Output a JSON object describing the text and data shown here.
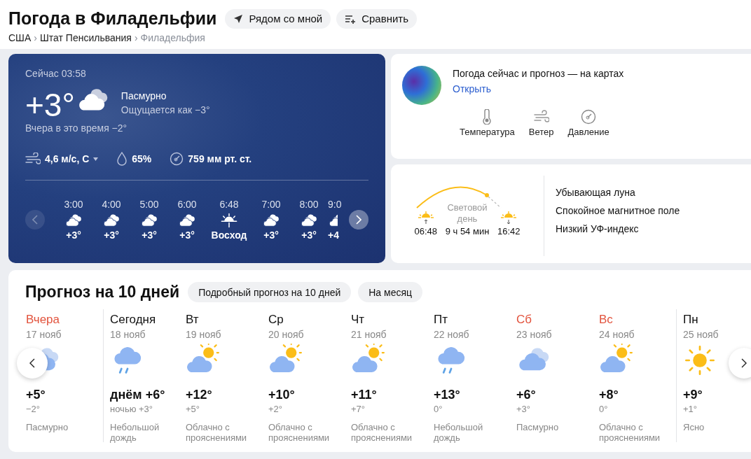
{
  "header": {
    "title": "Погода в Филадельфии",
    "buttons": [
      {
        "label": "Рядом со мной",
        "kind": "location"
      },
      {
        "label": "Сравнить",
        "kind": "compare"
      }
    ],
    "breadcrumbs": [
      {
        "label": "США",
        "current": false
      },
      {
        "separator": "›",
        "label": "Штат Пенсильвания",
        "current": false
      },
      {
        "separator": "›",
        "label": "Филадельфия",
        "current": true
      }
    ]
  },
  "now": {
    "time": "Сейчас 03:58",
    "temperature": "+3°",
    "condition": "Пасмурно",
    "feels_like": "Ощущается как −3°",
    "yesterday": "Вчера в это время −2°",
    "details": [
      {
        "kind": "wind",
        "value": "4,6 м/с, С"
      },
      {
        "kind": "humidity",
        "value": "65%"
      },
      {
        "kind": "pressure",
        "value": "759 мм рт. ст."
      }
    ],
    "hourly_prev": {
      "disabled": true
    },
    "hourly_next": {
      "disabled": false
    },
    "hourly": [
      {
        "time": "3:00",
        "kind": "hour",
        "value": "+3°"
      },
      {
        "time": "4:00",
        "kind": "hour",
        "value": "+3°"
      },
      {
        "time": "5:00",
        "kind": "hour",
        "value": "+3°"
      },
      {
        "time": "6:00",
        "kind": "hour",
        "value": "+3°"
      },
      {
        "time": "6:48",
        "kind": "sunrise",
        "value": "Восход"
      },
      {
        "time": "7:00",
        "kind": "hour",
        "value": "+3°"
      },
      {
        "time": "8:00",
        "kind": "hour",
        "value": "+3°"
      },
      {
        "time": "9:0",
        "kind": "hour",
        "value": "+4"
      }
    ]
  },
  "maps": {
    "title": "Погода сейчас и прогноз — на картах",
    "link": "Открыть",
    "layers": [
      {
        "label": "Температура",
        "kind": "thermometer"
      },
      {
        "label": "Ветер",
        "kind": "wind"
      },
      {
        "label": "Давление",
        "kind": "gauge"
      }
    ]
  },
  "sun": {
    "sunrise": "06:48",
    "daylight_label": "Световой день",
    "daylight": "9 ч 54 мин",
    "sunset": "16:42",
    "facts": [
      "Убывающая луна",
      "Спокойное магнитное поле",
      "Низкий УФ-индекс"
    ]
  },
  "forecast": {
    "title": "Прогноз на 10 дней",
    "buttons": [
      "Подробный прогноз на 10 дней",
      "На месяц"
    ],
    "days": [
      {
        "name": "Вчера",
        "accent": true,
        "separator_before": false,
        "date": "17 нояб",
        "kind": "overcast",
        "day": "+5°",
        "night": "−2°",
        "summary": "Пасмурно"
      },
      {
        "name": "Сегодня",
        "accent": false,
        "separator_before": true,
        "date": "18 нояб",
        "kind": "rain",
        "day": "днём +6°",
        "night": "ночью +3°",
        "summary": "Небольшой дождь"
      },
      {
        "name": "Вт",
        "accent": false,
        "separator_before": false,
        "date": "19 нояб",
        "kind": "partly",
        "day": "+12°",
        "night": "+5°",
        "summary": "Облачно с прояснениями"
      },
      {
        "name": "Ср",
        "accent": false,
        "separator_before": false,
        "date": "20 нояб",
        "kind": "partly",
        "day": "+10°",
        "night": "+2°",
        "summary": "Облачно с прояснениями"
      },
      {
        "name": "Чт",
        "accent": false,
        "separator_before": false,
        "date": "21 нояб",
        "kind": "partly",
        "day": "+11°",
        "night": "+7°",
        "summary": "Облачно с прояснениями"
      },
      {
        "name": "Пт",
        "accent": false,
        "separator_before": false,
        "date": "22 нояб",
        "kind": "rain",
        "day": "+13°",
        "night": "0°",
        "summary": "Небольшой дождь"
      },
      {
        "name": "Сб",
        "accent": true,
        "separator_before": false,
        "date": "23 нояб",
        "kind": "overcast",
        "day": "+6°",
        "night": "+3°",
        "summary": "Пасмурно"
      },
      {
        "name": "Вс",
        "accent": true,
        "separator_before": false,
        "date": "24 нояб",
        "kind": "partly",
        "day": "+8°",
        "night": "0°",
        "summary": "Облачно с прояснениями"
      },
      {
        "name": "Пн",
        "accent": false,
        "separator_before": true,
        "date": "25 нояб",
        "kind": "sun",
        "day": "+9°",
        "night": "+1°",
        "summary": "Ясно"
      }
    ]
  }
}
